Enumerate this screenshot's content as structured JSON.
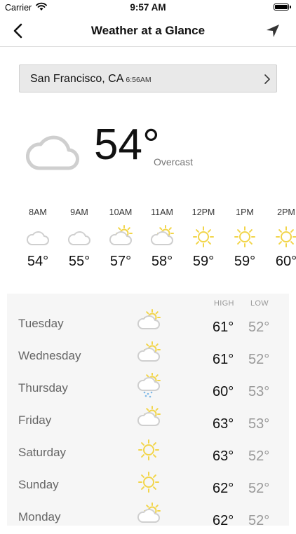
{
  "status_bar": {
    "carrier": "Carrier",
    "time": "9:57 AM"
  },
  "nav": {
    "title": "Weather at a Glance",
    "back_icon": "chevron-left-icon",
    "locate_icon": "location-arrow-icon"
  },
  "location": {
    "city": "San Francisco, CA",
    "time": "6:56AM"
  },
  "current": {
    "temp": "54°",
    "condition": "Overcast",
    "icon": "cloud-icon"
  },
  "hourly": [
    {
      "time": "8AM",
      "temp": "54°",
      "icon": "cloud"
    },
    {
      "time": "9AM",
      "temp": "55°",
      "icon": "cloud"
    },
    {
      "time": "10AM",
      "temp": "57°",
      "icon": "partly-sunny"
    },
    {
      "time": "11AM",
      "temp": "58°",
      "icon": "partly-sunny"
    },
    {
      "time": "12PM",
      "temp": "59°",
      "icon": "sun"
    },
    {
      "time": "1PM",
      "temp": "59°",
      "icon": "sun"
    },
    {
      "time": "2PM",
      "temp": "60°",
      "icon": "sun"
    }
  ],
  "daily": {
    "high_label": "HIGH",
    "low_label": "LOW",
    "days": [
      {
        "name": "Tuesday",
        "high": "61°",
        "low": "52°",
        "icon": "partly-sunny"
      },
      {
        "name": "Wednesday",
        "high": "61°",
        "low": "52°",
        "icon": "partly-sunny"
      },
      {
        "name": "Thursday",
        "high": "60°",
        "low": "53°",
        "icon": "rain-sun"
      },
      {
        "name": "Friday",
        "high": "63°",
        "low": "53°",
        "icon": "partly-sunny"
      },
      {
        "name": "Saturday",
        "high": "63°",
        "low": "52°",
        "icon": "sun"
      },
      {
        "name": "Sunday",
        "high": "62°",
        "low": "52°",
        "icon": "sun"
      },
      {
        "name": "Monday",
        "high": "62°",
        "low": "52°",
        "icon": "partly-sunny"
      }
    ]
  },
  "colors": {
    "sun": "#f2d54a",
    "cloud": "#cfcfcf",
    "rain": "#7fb9e6"
  }
}
